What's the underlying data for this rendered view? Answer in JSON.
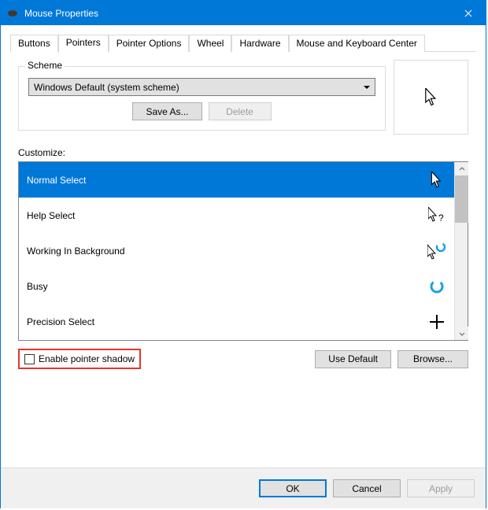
{
  "window": {
    "title": "Mouse Properties"
  },
  "tabs": [
    "Buttons",
    "Pointers",
    "Pointer Options",
    "Wheel",
    "Hardware",
    "Mouse and Keyboard Center"
  ],
  "activeTab": 1,
  "scheme": {
    "legend": "Scheme",
    "selected": "Windows Default (system scheme)",
    "save": "Save As...",
    "del": "Delete"
  },
  "customize": {
    "label": "Customize:",
    "items": [
      {
        "name": "Normal Select",
        "icon": "cursor-white",
        "selected": true
      },
      {
        "name": "Help Select",
        "icon": "cursor-help",
        "selected": false
      },
      {
        "name": "Working In Background",
        "icon": "cursor-working",
        "selected": false
      },
      {
        "name": "Busy",
        "icon": "cursor-busy",
        "selected": false
      },
      {
        "name": "Precision Select",
        "icon": "cursor-precision",
        "selected": false
      }
    ]
  },
  "enableShadow": "Enable pointer shadow",
  "useDefault": "Use Default",
  "browse": "Browse...",
  "footer": {
    "ok": "OK",
    "cancel": "Cancel",
    "apply": "Apply"
  }
}
